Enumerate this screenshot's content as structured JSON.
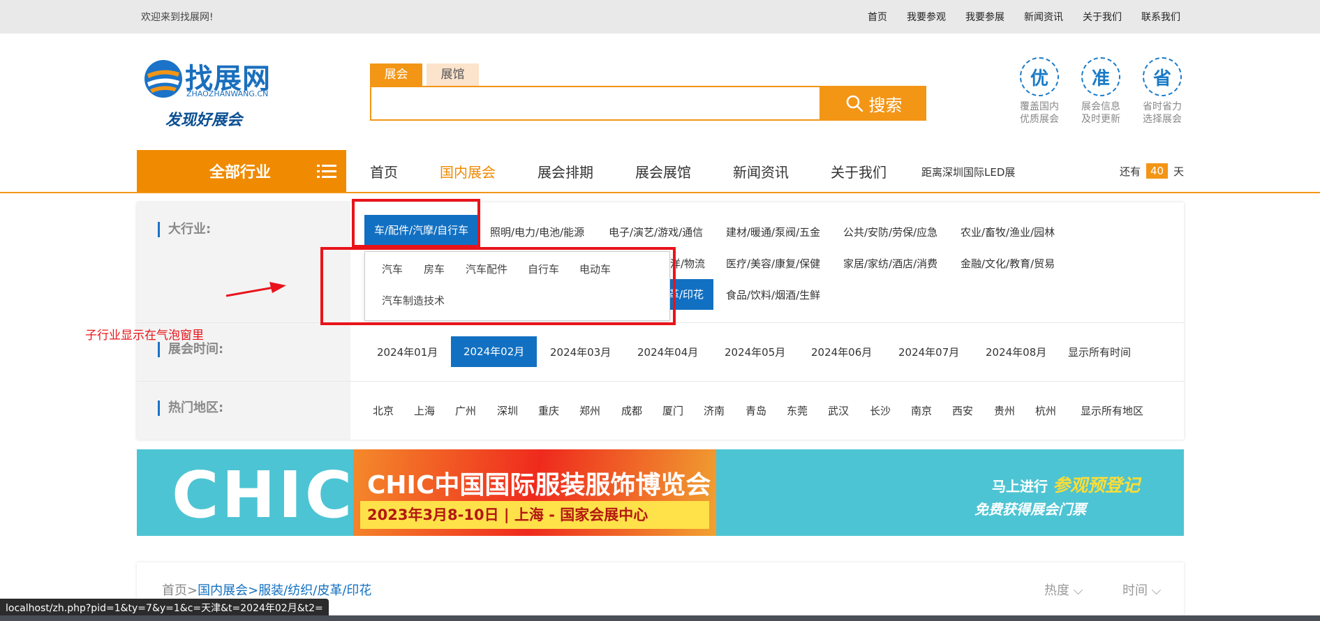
{
  "topbar": {
    "welcome": "欢迎来到找展网!",
    "links": [
      "首页",
      "我要参观",
      "我要参展",
      "新闻资讯",
      "关于我们",
      "联系我们"
    ]
  },
  "logo": {
    "name": "找展网",
    "domain": "ZHAOZHANWANG.CN",
    "slogan": "发现好展会"
  },
  "search": {
    "tabs": [
      "展会",
      "展馆"
    ],
    "button_label": "搜索",
    "placeholder": ""
  },
  "badges": [
    {
      "char": "优",
      "line1": "覆盖国内",
      "line2": "优质展会"
    },
    {
      "char": "准",
      "line1": "展会信息",
      "line2": "及时更新"
    },
    {
      "char": "省",
      "line1": "省时省力",
      "line2": "选择展会"
    }
  ],
  "nav": {
    "all_industries": "全部行业",
    "items": [
      "首页",
      "国内展会",
      "展会排期",
      "展会展馆",
      "新闻资讯",
      "关于我们"
    ],
    "active_index": 1,
    "countdown_text": "距离深圳国际LED展",
    "days_prefix": "还有",
    "days_value": "40",
    "days_suffix": "天"
  },
  "filters": {
    "industry_label": "大行业:",
    "time_label": "展会时间:",
    "region_label": "热门地区:",
    "industries_row1": [
      "车/配件/汽摩/自行车",
      "照明/电力/电池/能源",
      "电子/演艺/游戏/通信",
      "建材/暖通/泵阀/五金",
      "公共/安防/劳保/应急",
      "农业/畜牧/渔业/园林"
    ],
    "industries_row2_visible": [
      "洋/物流",
      "医疗/美容/康复/保健",
      "家居/家纺/酒店/消费",
      "金融/文化/教育/贸易"
    ],
    "industries_row3_visible": [
      "革/印花",
      "食品/饮料/烟酒/生鲜"
    ],
    "months": [
      "2024年01月",
      "2024年02月",
      "2024年03月",
      "2024年04月",
      "2024年05月",
      "2024年06月",
      "2024年07月",
      "2024年08月",
      "显示所有时间"
    ],
    "selected_month_index": 1,
    "regions": [
      "北京",
      "上海",
      "广州",
      "深圳",
      "重庆",
      "郑州",
      "成都",
      "厦门",
      "济南",
      "青岛",
      "东莞",
      "武汉",
      "长沙",
      "南京",
      "西安",
      "贵州",
      "杭州",
      "显示所有地区"
    ]
  },
  "subindustry_popup": {
    "items": [
      "汽车",
      "房车",
      "汽车配件",
      "自行车",
      "电动车",
      "汽车制造技术"
    ]
  },
  "annotation": {
    "text": "子行业显示在气泡窗里",
    "color": "#e8141a"
  },
  "banner": {
    "brand": "CHIC",
    "title": "CHIC中国国际服装服饰博览会",
    "date_venue": "2023年3月8-10日 | 上海 - 国家会展中心",
    "cta_prefix": "马上进行",
    "cta_highlight": "参观预登记",
    "cta_sub": "免费获得展会门票"
  },
  "results": {
    "crumb_home": "首页>",
    "crumb_links": [
      "国内展会>",
      "服装/纺织/皮革/印花"
    ],
    "sort_heat": "热度",
    "sort_time": "时间"
  },
  "statusbar": {
    "url": "localhost/zh.php?pid=1&ty=7&y=1&c=天津&t=2024年02月&t2="
  },
  "colors": {
    "accent_orange": "#f39515",
    "accent_blue": "#1270c2",
    "annotation_red": "#e8141a"
  }
}
